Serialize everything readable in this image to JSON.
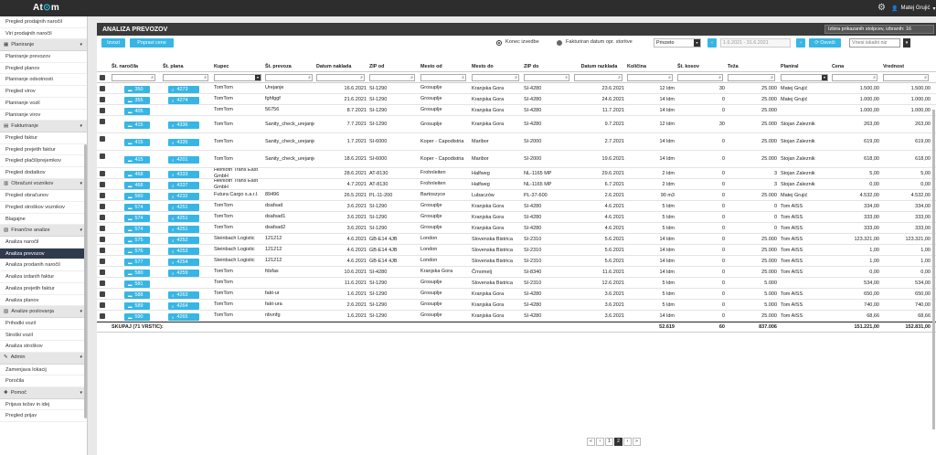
{
  "app": {
    "logo_left": "At",
    "logo_right": "m",
    "user": "Matej Grujić"
  },
  "sidebar": [
    {
      "type": "item",
      "label": "Pregled prodajnih naročil"
    },
    {
      "type": "item",
      "label": "Viri prodajnih naročil"
    },
    {
      "type": "head",
      "label": "Planiranje"
    },
    {
      "type": "item",
      "label": "Planiranje prevozov"
    },
    {
      "type": "item",
      "label": "Pregled planov"
    },
    {
      "type": "item",
      "label": "Planiranje odsotnosti"
    },
    {
      "type": "item",
      "label": "Pregled virov"
    },
    {
      "type": "item",
      "label": "Planiranje vozil"
    },
    {
      "type": "item",
      "label": "Planiranje virov"
    },
    {
      "type": "head",
      "label": "Fakturiranje"
    },
    {
      "type": "item",
      "label": "Pregled faktur"
    },
    {
      "type": "item",
      "label": "Pregled prejetih faktur"
    },
    {
      "type": "item",
      "label": "Pregled plačil/prejemkov"
    },
    {
      "type": "item",
      "label": "Pregled dodatkov"
    },
    {
      "type": "head",
      "label": "Obračuni voznikov"
    },
    {
      "type": "item",
      "label": "Pregled obračunov"
    },
    {
      "type": "item",
      "label": "Pregled stroškov voznikov"
    },
    {
      "type": "item",
      "label": "Blagajne"
    },
    {
      "type": "head",
      "label": "Finančne analize"
    },
    {
      "type": "item",
      "label": "Analiza naročil"
    },
    {
      "type": "item",
      "label": "Analiza prevozov",
      "active": true
    },
    {
      "type": "item",
      "label": "Analiza prodanih naročil"
    },
    {
      "type": "item",
      "label": "Analiza izdanih faktur"
    },
    {
      "type": "item",
      "label": "Analiza prejetih faktur"
    },
    {
      "type": "item",
      "label": "Analiza planov"
    },
    {
      "type": "head",
      "label": "Analize poslovanja"
    },
    {
      "type": "item",
      "label": "Prihodki vozil"
    },
    {
      "type": "item",
      "label": "Stroški vozil"
    },
    {
      "type": "item",
      "label": "Analiza stroškov"
    },
    {
      "type": "head",
      "label": "Admin"
    },
    {
      "type": "item",
      "label": "Zamenjava lokacij"
    },
    {
      "type": "item",
      "label": "Poročila"
    },
    {
      "type": "head",
      "label": "Pomoč"
    },
    {
      "type": "item",
      "label": "Prijava težav in idej"
    },
    {
      "type": "item",
      "label": "Pregled prijav"
    }
  ],
  "page": {
    "title": "ANALIZA PREVOZOV",
    "column_select": "Izbira prikazanih stolpcev, izbranih: 16"
  },
  "toolbar": {
    "btn_export": "Izvozi",
    "btn_fix": "Popravi cene",
    "radio1": "Konec izvedbe",
    "radio2": "Fakturiran datum opr. storitve",
    "select_value": "Privzeto",
    "date_range": "1.6.2021 - 31.6.2021",
    "refresh": "Osveži",
    "search_placeholder": "Vnesi iskalni niz"
  },
  "columns": [
    "Št. naročila",
    "Št. plana",
    "Kupec",
    "Št. prevoza",
    "Datum naklada",
    "ZIP od",
    "Mesto od",
    "Mesto do",
    "ZIP do",
    "Datum razklada",
    "Količina",
    "Št. kosov",
    "Teža",
    "Planiral",
    "Cena",
    "Vrednost"
  ],
  "rows": [
    {
      "order": "350",
      "plan": "4273",
      "kupec": "TomTom",
      "prevoz": "Urejanje",
      "nakl": "16.6.2021",
      "zipod": "SI-1290",
      "od": "Grosuplje",
      "do": "Kranjska Gora",
      "zipdo": "SI-4280",
      "razk": "23.6.2021",
      "kol": "12 ldm",
      "kos": "30",
      "teza": "25.000",
      "plan_by": "Matej Grujić",
      "cena": "1.500,00",
      "vred": "1.500,00"
    },
    {
      "order": "355",
      "plan": "4274",
      "kupec": "TomTom",
      "prevoz": "fghfggf",
      "nakl": "21.6.2021",
      "zipod": "SI-1290",
      "od": "Grosuplje",
      "do": "Kranjska Gora",
      "zipdo": "SI-4280",
      "razk": "24.6.2021",
      "kol": "14 ldm",
      "kos": "0",
      "teza": "25.000",
      "plan_by": "Matej Grujić",
      "cena": "1.000,00",
      "vred": "1.000,00"
    },
    {
      "order": "405",
      "plan": "",
      "kupec": "TomTom",
      "prevoz": "56756",
      "nakl": "8.7.2021",
      "zipod": "SI-1290",
      "od": "Grosuplje",
      "do": "Kranjska Gora",
      "zipdo": "SI-4280",
      "razk": "11.7.2021",
      "kol": "14 ldm",
      "kos": "0",
      "teza": "25.000",
      "plan_by": "",
      "cena": "1.000,00",
      "vred": "1.000,00"
    },
    {
      "order": "415",
      "plan": "4336",
      "kupec": "TomTom",
      "prevoz": "Sanity_check_urejanje",
      "nakl": "7.7.2021",
      "zipod": "SI-1290",
      "od": "Grosuplje",
      "do": "Kranjska Gora",
      "zipdo": "SI-4280",
      "razk": "9.7.2021",
      "kol": "12 ldm",
      "kos": "30",
      "teza": "25.000",
      "plan_by": "Stojan Zaleznik",
      "cena": "263,00",
      "vred": "263,00",
      "tall": true
    },
    {
      "order": "415",
      "plan": "4335",
      "kupec": "TomTom",
      "prevoz": "Sanity_check_urejanje",
      "nakl": "1.7.2021",
      "zipod": "SI-6000",
      "od": "Koper - Capodistria",
      "do": "Maribor",
      "zipdo": "SI-2000",
      "razk": "2.7.2021",
      "kol": "14 ldm",
      "kos": "0",
      "teza": "25.000",
      "plan_by": "Stojan Zaleznik",
      "cena": "619,00",
      "vred": "619,00",
      "tall": true
    },
    {
      "order": "415",
      "plan": "4201",
      "kupec": "TomTom",
      "prevoz": "Sanity_check_urejanje",
      "nakl": "18.6.2021",
      "zipod": "SI-6000",
      "od": "Koper - Capodistria",
      "do": "Maribor",
      "zipdo": "SI-2000",
      "razk": "19.6.2021",
      "kol": "14 ldm",
      "kos": "0",
      "teza": "25.000",
      "plan_by": "Stojan Zaleznik",
      "cena": "618,00",
      "vred": "618,00",
      "tall": true
    },
    {
      "order": "468",
      "plan": "4333",
      "kupec": "Heinloth Trans East GmbH",
      "prevoz": "",
      "nakl": "28.6.2021",
      "zipod": "AT-8130",
      "od": "Frohnleiten",
      "do": "Halfweg",
      "zipdo": "NL-1165 MP",
      "razk": "29.6.2021",
      "kol": "2 ldm",
      "kos": "0",
      "teza": "3",
      "plan_by": "Stojan Zaleznik",
      "cena": "5,00",
      "vred": "5,00"
    },
    {
      "order": "468",
      "plan": "4337",
      "kupec": "Heinloth Trans East GmbH",
      "prevoz": "",
      "nakl": "4.7.2021",
      "zipod": "AT-8130",
      "od": "Frohnleiten",
      "do": "Halfweg",
      "zipdo": "NL-1165 MP",
      "razk": "6.7.2021",
      "kol": "2 ldm",
      "kos": "0",
      "teza": "3",
      "plan_by": "Stojan Zaleznik",
      "cena": "0,00",
      "vred": "0,00"
    },
    {
      "order": "560",
      "plan": "4232",
      "kupec": "Futura Cargo s.a.r.l.",
      "prevoz": "89496",
      "nakl": "26.5.2021",
      "zipod": "PL-11-200",
      "od": "Bartoszyce",
      "do": "Lubaczów",
      "zipdo": "PL-37-600",
      "razk": "2.6.2021",
      "kol": "90 m3",
      "kos": "0",
      "teza": "25.000",
      "plan_by": "Matej Grujić",
      "cena": "4.532,00",
      "vred": "4.532,00"
    },
    {
      "order": "574",
      "plan": "4251",
      "kupec": "TomTom",
      "prevoz": "dsafsad",
      "nakl": "3.6.2021",
      "zipod": "SI-1290",
      "od": "Grosuplje",
      "do": "Kranjska Gora",
      "zipdo": "SI-4280",
      "razk": "4.6.2021",
      "kol": "5 ldm",
      "kos": "0",
      "teza": "0",
      "plan_by": "Tom AISS",
      "cena": "334,00",
      "vred": "334,00"
    },
    {
      "order": "574",
      "plan": "4251",
      "kupec": "TomTom",
      "prevoz": "dsafsad1",
      "nakl": "3.6.2021",
      "zipod": "SI-1290",
      "od": "Grosuplje",
      "do": "Kranjska Gora",
      "zipdo": "SI-4280",
      "razk": "4.6.2021",
      "kol": "5 ldm",
      "kos": "0",
      "teza": "0",
      "plan_by": "Tom AISS",
      "cena": "333,00",
      "vred": "333,00"
    },
    {
      "order": "574",
      "plan": "4251",
      "kupec": "TomTom",
      "prevoz": "dsafsad2",
      "nakl": "3.6.2021",
      "zipod": "SI-1290",
      "od": "Grosuplje",
      "do": "Kranjska Gora",
      "zipdo": "SI-4280",
      "razk": "4.6.2021",
      "kol": "5 ldm",
      "kos": "0",
      "teza": "0",
      "plan_by": "Tom AISS",
      "cena": "333,00",
      "vred": "333,00"
    },
    {
      "order": "575",
      "plan": "4252",
      "kupec": "Steinbach Logistic",
      "prevoz": "121212",
      "nakl": "4.6.2021",
      "zipod": "GB-E14 4JB",
      "od": "London",
      "do": "Slovenska Bistrica",
      "zipdo": "SI-2310",
      "razk": "5.6.2021",
      "kol": "14 ldm",
      "kos": "0",
      "teza": "25.000",
      "plan_by": "Tom AISS",
      "cena": "123.321,00",
      "vred": "123.321,00"
    },
    {
      "order": "576",
      "plan": "4253",
      "kupec": "Steinbach Logistic",
      "prevoz": "121212",
      "nakl": "4.6.2021",
      "zipod": "GB-E14 4JB",
      "od": "London",
      "do": "Slovenska Bistrica",
      "zipdo": "SI-2310",
      "razk": "5.6.2021",
      "kol": "14 ldm",
      "kos": "0",
      "teza": "25.000",
      "plan_by": "Tom AISS",
      "cena": "1,00",
      "vred": "1,00"
    },
    {
      "order": "577",
      "plan": "4254",
      "kupec": "Steinbach Logistic",
      "prevoz": "121212",
      "nakl": "4.6.2021",
      "zipod": "GB-E14 4JB",
      "od": "London",
      "do": "Slovenska Bistrica",
      "zipdo": "SI-2310",
      "razk": "5.6.2021",
      "kol": "14 ldm",
      "kos": "0",
      "teza": "25.000",
      "plan_by": "Tom AISS",
      "cena": "1,00",
      "vred": "1,00"
    },
    {
      "order": "580",
      "plan": "4259",
      "kupec": "TomTom",
      "prevoz": "fdsfas",
      "nakl": "10.6.2021",
      "zipod": "SI-4280",
      "od": "Kranjska Gora",
      "do": "Črnomelj",
      "zipdo": "SI-8340",
      "razk": "11.6.2021",
      "kol": "14 ldm",
      "kos": "0",
      "teza": "25.000",
      "plan_by": "Tom AISS",
      "cena": "0,00",
      "vred": "0,00"
    },
    {
      "order": "581",
      "plan": "",
      "kupec": "TomTom",
      "prevoz": "",
      "nakl": "11.6.2021",
      "zipod": "SI-1290",
      "od": "Grosuplje",
      "do": "Slovenska Bistrica",
      "zipdo": "SI-2310",
      "razk": "12.6.2021",
      "kol": "5 ldm",
      "kos": "0",
      "teza": "5.000",
      "plan_by": "",
      "cena": "534,00",
      "vred": "534,00"
    },
    {
      "order": "588",
      "plan": "4263",
      "kupec": "TomTom",
      "prevoz": "fakt-ur",
      "nakl": "1.6.2021",
      "zipod": "SI-1290",
      "od": "Grosuplje",
      "do": "Kranjska Gora",
      "zipdo": "SI-4280",
      "razk": "3.6.2021",
      "kol": "5 ldm",
      "kos": "0",
      "teza": "5.000",
      "plan_by": "Tom AISS",
      "cena": "650,00",
      "vred": "650,00"
    },
    {
      "order": "589",
      "plan": "4264",
      "kupec": "TomTom",
      "prevoz": "fakt-ura",
      "nakl": "2.6.2021",
      "zipod": "SI-1290",
      "od": "Grosuplje",
      "do": "Kranjska Gora",
      "zipdo": "SI-4280",
      "razk": "3.6.2021",
      "kol": "5 ldm",
      "kos": "0",
      "teza": "5.000",
      "plan_by": "Tom AISS",
      "cena": "740,00",
      "vred": "740,00"
    },
    {
      "order": "590",
      "plan": "4265",
      "kupec": "TomTom",
      "prevoz": "nbvnfg",
      "nakl": "1.6.2021",
      "zipod": "SI-1290",
      "od": "Grosuplje",
      "do": "Kranjska Gora",
      "zipdo": "SI-4280",
      "razk": "3.6.2021",
      "kol": "14 ldm",
      "kos": "0",
      "teza": "25.000",
      "plan_by": "Tom AISS",
      "cena": "68,66",
      "vred": "68,66"
    }
  ],
  "summary": {
    "label": "SKUPAJ (71 VRSTIC):",
    "kol": "52.619",
    "kos": "60",
    "teza": "837.006",
    "cena": "151.221,00",
    "vred": "152.831,00"
  },
  "pager": {
    "first": "«",
    "prev": "‹",
    "pages": [
      "1",
      "2"
    ],
    "active": "2",
    "next": "›",
    "last": "»"
  }
}
